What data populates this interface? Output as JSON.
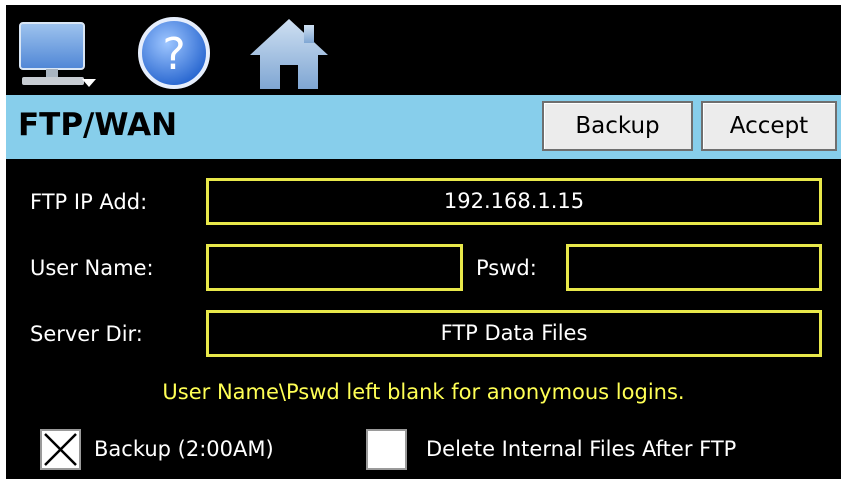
{
  "toolbar": {
    "icons": [
      "monitor-icon",
      "help-icon",
      "home-icon"
    ]
  },
  "header": {
    "title": "FTP/WAN",
    "backup_label": "Backup",
    "accept_label": "Accept"
  },
  "form": {
    "ftp_ip_label": "FTP IP Add:",
    "ftp_ip_value": "192.168.1.15",
    "user_name_label": "User Name:",
    "user_name_value": "",
    "pswd_label": "Pswd:",
    "pswd_value": "",
    "server_dir_label": "Server Dir:",
    "server_dir_value": "FTP Data Files",
    "note": "User Name\\Pswd left blank for anonymous logins."
  },
  "options": {
    "backup_label": "Backup (2:00AM)",
    "backup_checked": true,
    "delete_label": "Delete Internal Files After FTP",
    "delete_checked": false
  },
  "colors": {
    "background": "#000000",
    "titlebar": "#87ceeb",
    "field_border": "#e8e84a",
    "note_text": "#ffff55"
  }
}
